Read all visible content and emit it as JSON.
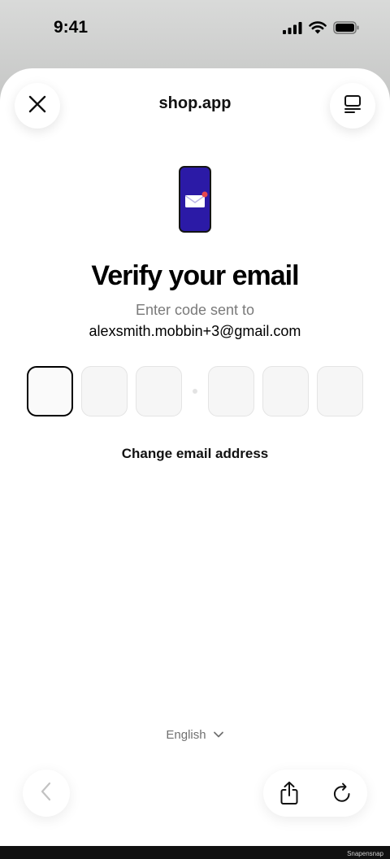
{
  "status_bar": {
    "time": "9:41",
    "icons": [
      "signal-icon",
      "wifi-icon",
      "battery-icon"
    ]
  },
  "header": {
    "title": "shop.app",
    "close_icon": "close-icon",
    "menu_icon": "tabs-icon"
  },
  "illustration": {
    "icon": "phone-envelope-icon",
    "phone_color": "#2b1aa6",
    "notification_color": "#e5484d"
  },
  "main": {
    "heading": "Verify your email",
    "subtext": "Enter code sent to",
    "email": "alexsmith.mobbin+3@gmail.com",
    "code_boxes": [
      "",
      "",
      "",
      "",
      "",
      ""
    ],
    "active_box_index": 0,
    "change_email_label": "Change email address"
  },
  "footer": {
    "language": "English",
    "language_icon": "chevron-down-icon"
  },
  "nav": {
    "back_icon": "chevron-left-icon",
    "share_icon": "share-icon",
    "reload_icon": "reload-icon"
  },
  "watermark": "Snapensnap"
}
